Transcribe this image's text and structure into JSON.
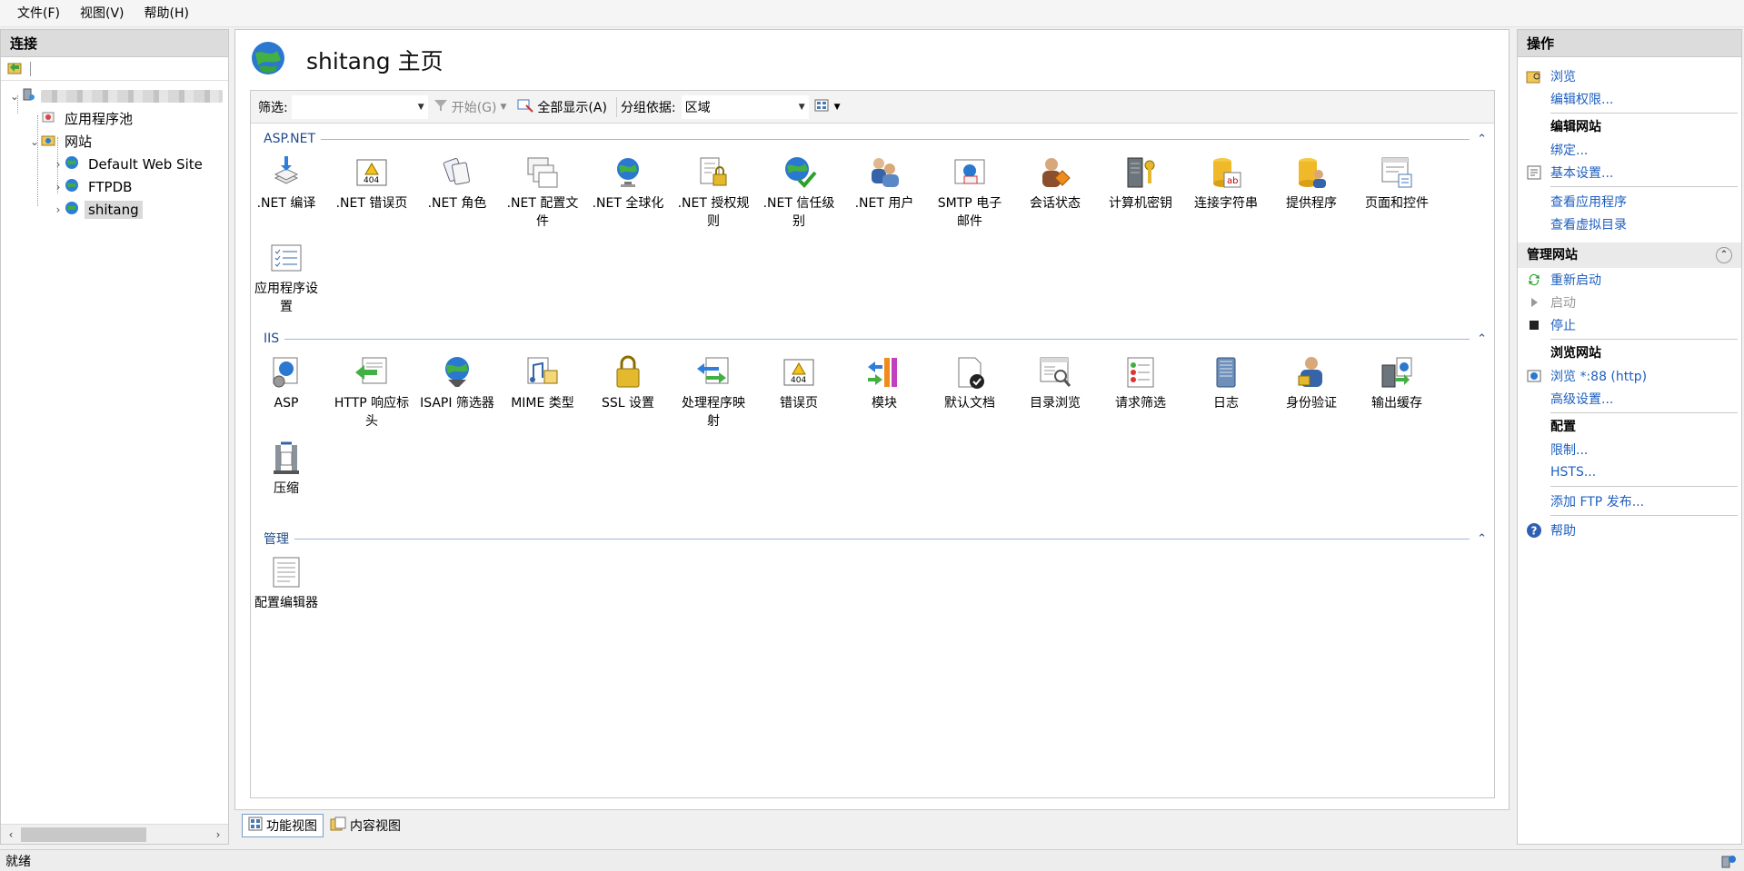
{
  "menu": [
    "文件(F)",
    "视图(V)",
    "帮助(H)"
  ],
  "connections": {
    "title": "连接",
    "tree": {
      "app_pools": "应用程序池",
      "sites": "网站",
      "site_items": [
        "Default Web Site",
        "FTPDB",
        "shitang"
      ]
    }
  },
  "center": {
    "title": "shitang 主页",
    "filter_label": "筛选:",
    "filter_value": "",
    "start_button": "开始(G)",
    "show_all_button": "全部显示(A)",
    "group_by_label": "分组依据:",
    "group_by_value": "区域"
  },
  "groups": [
    {
      "title": "ASP.NET",
      "features": [
        {
          "l1": ".NET 编译",
          "l2": ""
        },
        {
          "l1": ".NET 错误页",
          "l2": ""
        },
        {
          "l1": ".NET 角色",
          "l2": ""
        },
        {
          "l1": ".NET 配置文",
          "l2": "件"
        },
        {
          "l1": ".NET 全球化",
          "l2": ""
        },
        {
          "l1": ".NET 授权规",
          "l2": "则"
        },
        {
          "l1": ".NET 信任级",
          "l2": "别"
        },
        {
          "l1": ".NET 用户",
          "l2": ""
        },
        {
          "l1": "SMTP 电子",
          "l2": "邮件"
        },
        {
          "l1": "会话状态",
          "l2": ""
        },
        {
          "l1": "计算机密钥",
          "l2": ""
        },
        {
          "l1": "连接字符串",
          "l2": ""
        },
        {
          "l1": "提供程序",
          "l2": ""
        },
        {
          "l1": "页面和控件",
          "l2": ""
        },
        {
          "l1": "应用程序设",
          "l2": "置"
        }
      ]
    },
    {
      "title": "IIS",
      "features": [
        {
          "l1": "ASP",
          "l2": ""
        },
        {
          "l1": "HTTP 响应标",
          "l2": "头"
        },
        {
          "l1": "ISAPI 筛选器",
          "l2": ""
        },
        {
          "l1": "MIME 类型",
          "l2": ""
        },
        {
          "l1": "SSL 设置",
          "l2": ""
        },
        {
          "l1": "处理程序映",
          "l2": "射"
        },
        {
          "l1": "错误页",
          "l2": ""
        },
        {
          "l1": "模块",
          "l2": ""
        },
        {
          "l1": "默认文档",
          "l2": ""
        },
        {
          "l1": "目录浏览",
          "l2": ""
        },
        {
          "l1": "请求筛选",
          "l2": ""
        },
        {
          "l1": "日志",
          "l2": ""
        },
        {
          "l1": "身份验证",
          "l2": ""
        },
        {
          "l1": "输出缓存",
          "l2": ""
        },
        {
          "l1": "压缩",
          "l2": ""
        }
      ]
    },
    {
      "title": "管理",
      "features": [
        {
          "l1": "配置编辑器",
          "l2": ""
        }
      ]
    }
  ],
  "view_tabs": [
    "功能视图",
    "内容视图"
  ],
  "actions": {
    "title": "操作",
    "explore": "浏览",
    "edit_permissions": "编辑权限...",
    "edit_site_heading": "编辑网站",
    "bindings": "绑定...",
    "basic_settings": "基本设置...",
    "view_apps": "查看应用程序",
    "view_vdirs": "查看虚拟目录",
    "manage_site_heading": "管理网站",
    "restart": "重新启动",
    "start": "启动",
    "stop": "停止",
    "browse_site_heading": "浏览网站",
    "browse_http": "浏览 *:88 (http)",
    "advanced_settings": "高级设置...",
    "config_heading": "配置",
    "limits": "限制...",
    "hsts": "HSTS...",
    "add_ftp": "添加 FTP 发布...",
    "help": "帮助"
  },
  "status": "就绪",
  "colors": {
    "link": "#1e5fbf",
    "group_title": "#1f4a8a",
    "pane_header": "#dcdcdc"
  }
}
